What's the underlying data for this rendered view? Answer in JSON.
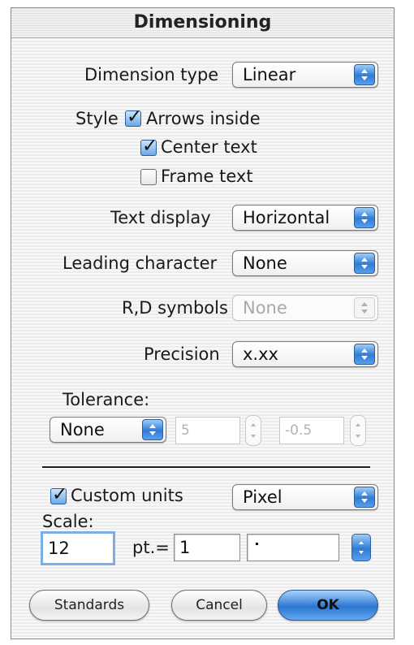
{
  "dialog": {
    "title": "Dimensioning"
  },
  "fields": {
    "dimension_type": {
      "label": "Dimension type",
      "value": "Linear"
    },
    "style_label": "Style",
    "arrows_inside": {
      "label": "Arrows inside",
      "checked": true
    },
    "center_text": {
      "label": "Center text",
      "checked": true
    },
    "frame_text": {
      "label": "Frame text",
      "checked": false
    },
    "text_display": {
      "label": "Text display",
      "value": "Horizontal"
    },
    "leading_character": {
      "label": "Leading character",
      "value": "None"
    },
    "rd_symbols": {
      "label": "R,D symbols",
      "value": "None"
    },
    "precision": {
      "label": "Precision",
      "value": "x.xx"
    }
  },
  "tolerance": {
    "label": "Tolerance:",
    "mode": "None",
    "upper": "5",
    "lower": "-0.5"
  },
  "custom_units": {
    "label": "Custom units",
    "checked": true,
    "unit": "Pixel",
    "scale_label": "Scale:",
    "scale_value": "12",
    "pt_label": "pt.=",
    "pt_value": "1",
    "unit_field_value": ""
  },
  "buttons": {
    "standards": "Standards",
    "cancel": "Cancel",
    "ok": "OK"
  },
  "colors": {
    "accent": "#2f7bd6"
  }
}
